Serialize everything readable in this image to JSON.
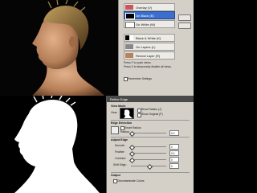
{
  "view_menu": {
    "items": [
      {
        "label": "Overlay (V)",
        "thumb": "overlay-thumb"
      },
      {
        "label": "On Black (B)",
        "thumb": "on-black-thumb",
        "selected": true
      },
      {
        "label": "On White (W)",
        "thumb": "on-white-thumb"
      },
      {
        "label": "Black & White (K)",
        "thumb": "black-white-thumb"
      },
      {
        "label": "On Layers (L)",
        "thumb": "on-layers-thumb"
      },
      {
        "label": "Reveal Layer (R)",
        "thumb": "reveal-layer-thumb"
      }
    ],
    "hint1": "Press F to cycle views.",
    "hint2": "Press X to temporarily disable all views.",
    "remember_label": "Remember Settings"
  },
  "refine_edge": {
    "title": "Refine Edge",
    "view_mode_section": "View Mode",
    "view_label": "View:",
    "show_radius": "Show Radius (J)",
    "show_original": "Show Original (P)",
    "edge_detection_section": "Edge Detection",
    "smart_radius": "Smart Radius",
    "radius_label": "Radius:",
    "radius_value": "0.0",
    "radius_fraction": 0.0,
    "adjust_edge_section": "Adjust Edge",
    "smooth_label": "Smooth:",
    "smooth_value": "0",
    "smooth_fraction": 0.0,
    "feather_label": "Feather:",
    "feather_value": "0.0",
    "feather_fraction": 0.0,
    "contrast_label": "Contrast:",
    "contrast_value": "0",
    "contrast_fraction": 0.0,
    "shift_edge_label": "Shift Edge:",
    "shift_edge_value": "0",
    "shift_edge_fraction": 0.5,
    "output_section": "Output",
    "decontaminate_label": "Decontaminate Colors"
  },
  "colors": {
    "selection": "#3a6fcf",
    "dialog_bg": "#d4d0c8",
    "skin": "#c9956f",
    "hair": "#8a6a3a"
  }
}
